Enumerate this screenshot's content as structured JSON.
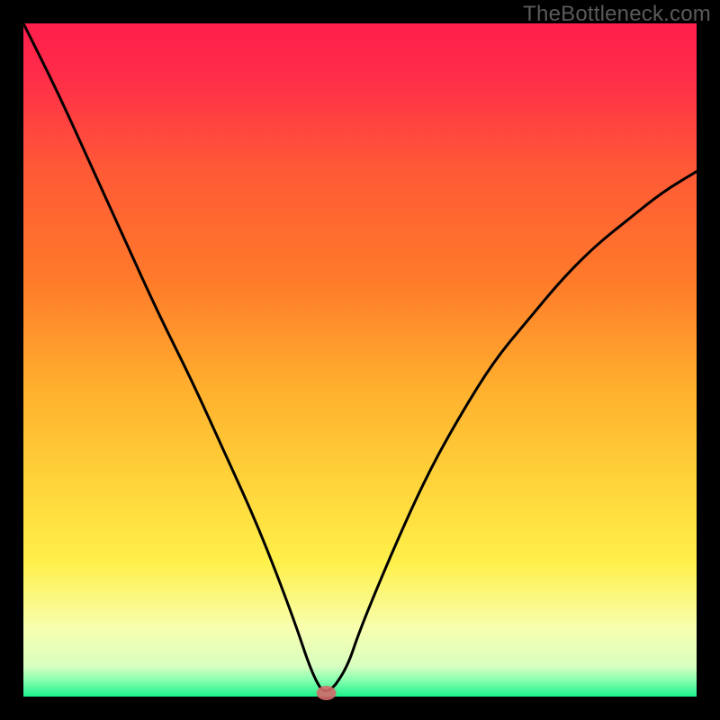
{
  "watermark": "TheBottleneck.com",
  "chart_data": {
    "type": "line",
    "title": "",
    "xlabel": "",
    "ylabel": "",
    "xlim": [
      0,
      100
    ],
    "ylim": [
      0,
      100
    ],
    "grid": false,
    "x": [
      0,
      5,
      10,
      15,
      20,
      25,
      30,
      35,
      40,
      43,
      45,
      48,
      50,
      55,
      60,
      65,
      70,
      75,
      80,
      85,
      90,
      95,
      100
    ],
    "values": [
      100,
      90,
      79,
      68,
      57,
      47,
      36,
      25,
      12,
      3,
      0,
      4,
      10,
      22,
      33,
      42,
      50,
      56,
      62,
      67,
      71,
      75,
      78
    ],
    "marker": {
      "x": 45,
      "y": 0
    },
    "colors": {
      "gradient_top": "#ff1f4b",
      "gradient_mid_upper": "#ff7a2a",
      "gradient_mid": "#ffd33a",
      "gradient_mid_lower": "#fff04a",
      "gradient_lower": "#f7ffb0",
      "gradient_bottom": "#1bf28a",
      "frame": "#000000",
      "curve": "#000000",
      "marker_fill": "#d46a6a"
    }
  }
}
